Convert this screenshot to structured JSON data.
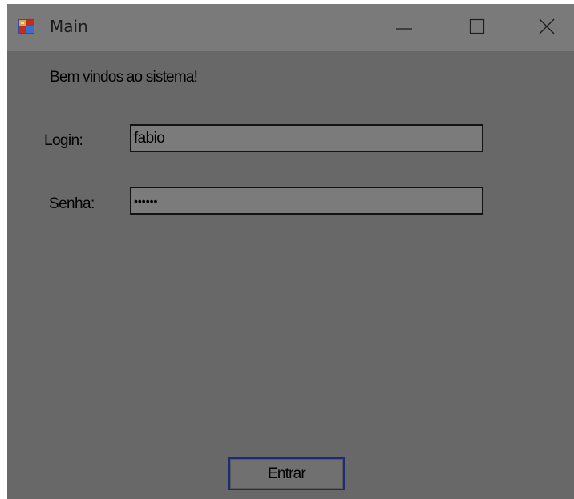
{
  "window": {
    "title": "Main",
    "icon": "app-form-icon",
    "controls": {
      "minimize": "minimize-icon",
      "maximize": "maximize-icon",
      "close": "close-icon"
    }
  },
  "form": {
    "welcome_text": "Bem vindos ao sistema!",
    "login_label": "Login:",
    "login_value": "fabio",
    "password_label": "Senha:",
    "password_value": "••••••",
    "submit_label": "Entrar"
  },
  "colors": {
    "titlebar": "#7a7a7a",
    "client_area": "#686868",
    "field_background": "#7b7b7b",
    "button_border": "#1c2a78"
  }
}
